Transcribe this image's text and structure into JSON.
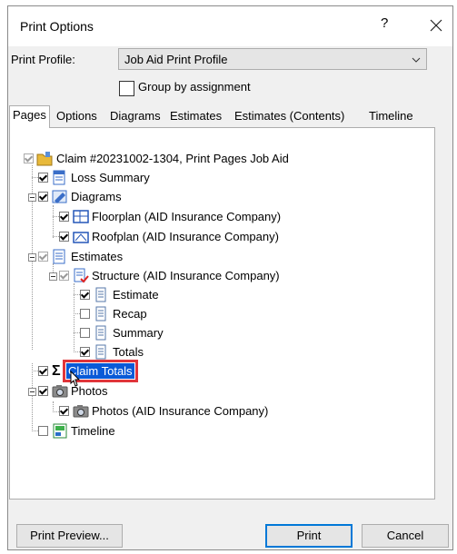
{
  "window": {
    "title": "Print Options",
    "help": "?"
  },
  "profile": {
    "label": "Print Profile:",
    "value": "Job Aid Print Profile"
  },
  "group_by_assignment": {
    "label": "Group by assignment",
    "checked": false
  },
  "tabs": [
    {
      "label": "Pages",
      "active": true
    },
    {
      "label": "Options"
    },
    {
      "label": "Diagrams"
    },
    {
      "label": "Estimates"
    },
    {
      "label": "Estimates (Contents)"
    },
    {
      "label": "Timeline"
    }
  ],
  "tree": {
    "claim": "Claim #20231002-1304, Print Pages Job Aid",
    "loss_summary": "Loss Summary",
    "diagrams": "Diagrams",
    "floorplan": "Floorplan (AID Insurance Company)",
    "roofplan": "Roofplan (AID Insurance Company)",
    "estimates": "Estimates",
    "structure": "Structure (AID Insurance Company)",
    "estimate": "Estimate",
    "recap": "Recap",
    "summary": "Summary",
    "totals": "Totals",
    "claim_totals": "Claim Totals",
    "photos": "Photos",
    "photos_child": "Photos (AID Insurance Company)",
    "timeline": "Timeline"
  },
  "buttons": {
    "preview": "Print Preview...",
    "print": "Print",
    "cancel": "Cancel"
  },
  "colors": {
    "selection": "#0a5ad7",
    "highlight_outline": "#e0353a",
    "accent": "#0078d7"
  }
}
